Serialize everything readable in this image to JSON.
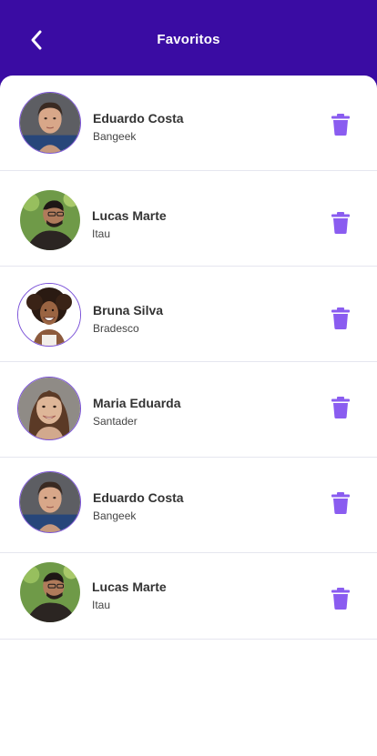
{
  "header": {
    "title": "Favoritos",
    "back_icon": "chevron-left-icon"
  },
  "colors": {
    "header_bg": "#3a0ca3",
    "accent": "#8a5cf0",
    "avatar_border": "#7b52d8",
    "divider": "#e5e6ef"
  },
  "favorites": [
    {
      "name": "Eduardo Costa",
      "company": "Bangeek",
      "avatar": "avatar-eduardo-icon",
      "action_icon": "trash-icon"
    },
    {
      "name": "Lucas Marte",
      "company": "Itau",
      "avatar": "avatar-lucas-icon",
      "action_icon": "trash-icon"
    },
    {
      "name": "Bruna Silva",
      "company": "Bradesco",
      "avatar": "avatar-bruna-icon",
      "action_icon": "trash-icon"
    },
    {
      "name": "Maria Eduarda",
      "company": "Santader",
      "avatar": "avatar-maria-icon",
      "action_icon": "trash-icon"
    },
    {
      "name": "Eduardo Costa",
      "company": "Bangeek",
      "avatar": "avatar-eduardo-icon",
      "action_icon": "trash-icon"
    },
    {
      "name": "Lucas Marte",
      "company": "Itau",
      "avatar": "avatar-lucas-icon",
      "action_icon": "trash-icon"
    }
  ]
}
